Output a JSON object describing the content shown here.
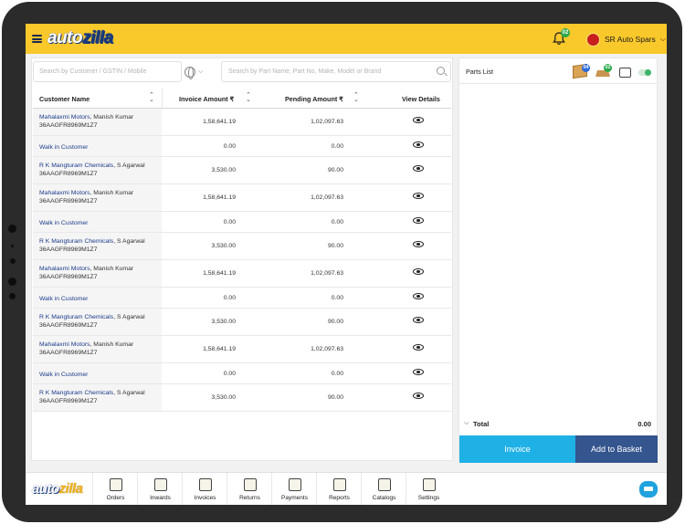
{
  "header": {
    "logo_white": "auto",
    "logo_blue": "zilla",
    "notification_count": "02",
    "store_name": "SR Auto Spars"
  },
  "search": {
    "customer_placeholder": "Search by Customer / GSTIN / Mobile",
    "part_placeholder": "Search by Part Name, Part No, Make, Model or Brand"
  },
  "table": {
    "headers": {
      "customer": "Customer Name",
      "invoice": "Invoice Amount ₹",
      "pending": "Pending Amount ₹",
      "details": "View Details"
    },
    "rows": [
      {
        "name": "Mahalaxmi Motors",
        "contact": ", Manish Kumar",
        "gstin": "36AAGFR8969M1Z7",
        "invoice": "1,58,641.19",
        "pending": "1,02,097.63"
      },
      {
        "name": "Walk in Customer",
        "contact": "",
        "gstin": "",
        "invoice": "0.00",
        "pending": "0.00"
      },
      {
        "name": "R K Mangturam Chemicals",
        "contact": ", S Agarwal",
        "gstin": "36AAGFR8969M1Z7",
        "invoice": "3,530.00",
        "pending": "90.00"
      },
      {
        "name": "Mahalaxmi Motors",
        "contact": ", Manish Kumar",
        "gstin": "36AAGFR8969M1Z7",
        "invoice": "1,58,641.19",
        "pending": "1,02,097.63"
      },
      {
        "name": "Walk in Customer",
        "contact": "",
        "gstin": "",
        "invoice": "0.00",
        "pending": "0.00"
      },
      {
        "name": "R K Mangturam Chemicals",
        "contact": ", S Agarwal",
        "gstin": "36AAGFR8969M1Z7",
        "invoice": "3,530.00",
        "pending": "90.00"
      },
      {
        "name": "Mahalaxmi Motors",
        "contact": ", Manish Kumar",
        "gstin": "36AAGFR8969M1Z7",
        "invoice": "1,58,641.19",
        "pending": "1,02,097.63"
      },
      {
        "name": "Walk in Customer",
        "contact": "",
        "gstin": "",
        "invoice": "0.00",
        "pending": "0.00"
      },
      {
        "name": "R K Mangturam Chemicals",
        "contact": ", S Agarwal",
        "gstin": "36AAGFR8969M1Z7",
        "invoice": "3,530.00",
        "pending": "90.00"
      },
      {
        "name": "Mahalaxmi Motors",
        "contact": ", Manish Kumar",
        "gstin": "36AAGFR8969M1Z7",
        "invoice": "1,58,641.19",
        "pending": "1,02,097.63"
      },
      {
        "name": "Walk in Customer",
        "contact": "",
        "gstin": "",
        "invoice": "0.00",
        "pending": "0.00"
      },
      {
        "name": "R K Mangturam Chemicals",
        "contact": ", S Agarwal",
        "gstin": "36AAGFR8969M1Z7",
        "invoice": "3,530.00",
        "pending": "90.00"
      }
    ]
  },
  "parts": {
    "title": "Parts List",
    "box_count": "04",
    "basket_count": "02",
    "total_label": "Total",
    "total_value": "0.00",
    "invoice_button": "Invoice",
    "basket_button": "Add to Basket"
  },
  "bottom_nav": {
    "logo_white": "auto",
    "logo_gold": "zilla",
    "items": [
      {
        "label": "Orders",
        "icon": "orders-icon"
      },
      {
        "label": "Inwards",
        "icon": "inwards-icon"
      },
      {
        "label": "Invoices",
        "icon": "invoices-icon"
      },
      {
        "label": "Returns",
        "icon": "returns-icon"
      },
      {
        "label": "Payments",
        "icon": "payments-icon"
      },
      {
        "label": "Reports",
        "icon": "reports-icon"
      },
      {
        "label": "Catalogs",
        "icon": "catalogs-icon"
      },
      {
        "label": "Settings",
        "icon": "settings-icon"
      }
    ]
  },
  "colors": {
    "header_bg": "#f9c82b",
    "brand_blue": "#1a3a7a",
    "invoice_button": "#1fb0e6",
    "basket_button": "#35558e",
    "notification_badge": "#2aa84a"
  }
}
